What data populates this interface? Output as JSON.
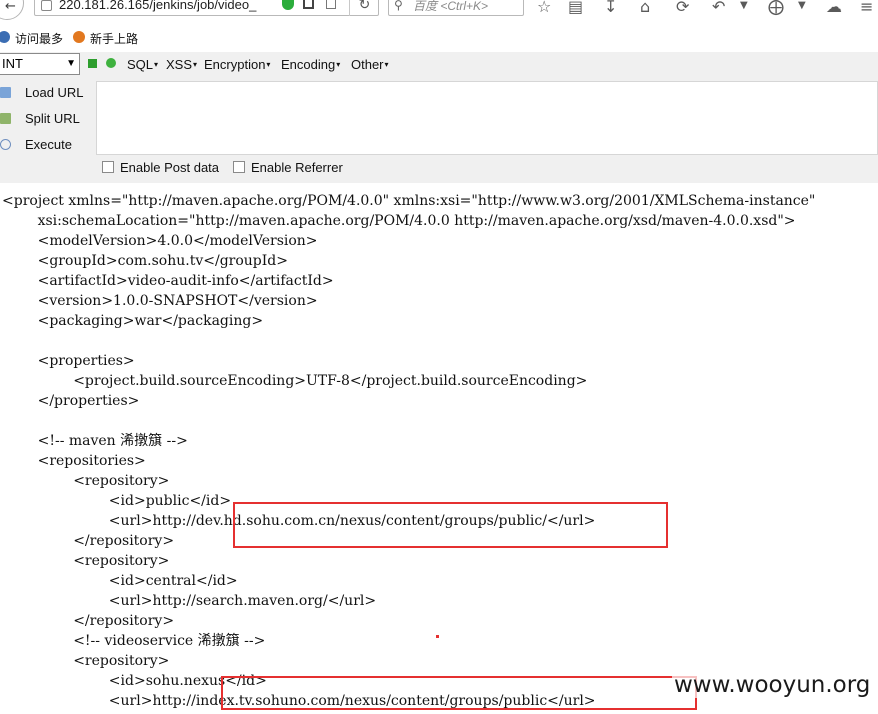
{
  "browser": {
    "url": "220.181.26.165/jenkins/job/video_",
    "search_placeholder": "百度 <Ctrl+K>",
    "icons": [
      "back-arrow-icon",
      "shield-icon",
      "qr-code-icon",
      "reload-icon",
      "bookmark-star-icon",
      "reading-list-icon",
      "download-icon",
      "home-icon",
      "sync-icon",
      "undo-icon",
      "screenshot-crop-icon",
      "chat-icon"
    ]
  },
  "bookmarks": {
    "items": [
      {
        "label": "访问最多",
        "icon": "gear-icon"
      },
      {
        "label": "新手上路",
        "icon": "firefox-icon"
      }
    ]
  },
  "hackbar": {
    "select_value": "INT",
    "menus": [
      {
        "label": "SQL"
      },
      {
        "label": "XSS"
      },
      {
        "label": "Encryption"
      },
      {
        "label": "Encoding"
      },
      {
        "label": "Other"
      }
    ],
    "actions": {
      "load": "Load URL",
      "split": "Split URL",
      "execute": "Execute"
    },
    "checkboxes": {
      "post": "Enable Post data",
      "referrer": "Enable Referrer"
    }
  },
  "source": {
    "lines": [
      "<project xmlns=\"http://maven.apache.org/POM/4.0.0\" xmlns:xsi=\"http://www.w3.org/2001/XMLSchema-instance\"",
      "        xsi:schemaLocation=\"http://maven.apache.org/POM/4.0.0 http://maven.apache.org/xsd/maven-4.0.0.xsd\">",
      "        <modelVersion>4.0.0</modelVersion>",
      "        <groupId>com.sohu.tv</groupId>",
      "        <artifactId>video-audit-info</artifactId>",
      "        <version>1.0.0-SNAPSHOT</version>",
      "        <packaging>war</packaging>",
      "",
      "        <properties>",
      "                <project.build.sourceEncoding>UTF-8</project.build.sourceEncoding>",
      "        </properties>",
      "",
      "        <!-- maven 浠撴簱 -->",
      "        <repositories>",
      "                <repository>",
      "                        <id>public</id>",
      "                        <url>http://dev.hd.sohu.com.cn/nexus/content/groups/public/</url>",
      "                </repository>",
      "                <repository>",
      "                        <id>central</id>",
      "                        <url>http://search.maven.org/</url>",
      "                </repository>",
      "                <!-- videoservice 浠撴簱 -->",
      "                <repository>",
      "                        <id>sohu.nexus</id>",
      "                        <url>http://index.tv.sohuno.com/nexus/content/groups/public</url>"
    ]
  },
  "watermark": "www.wooyun.org",
  "colors": {
    "highlight": "#e53030",
    "hackbar_bg": "#f0f0f0"
  }
}
